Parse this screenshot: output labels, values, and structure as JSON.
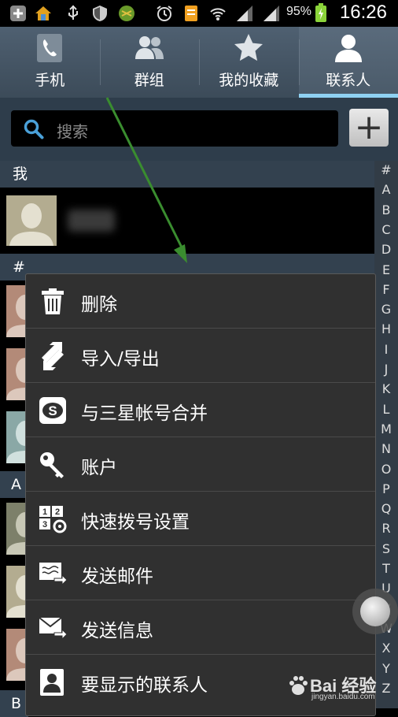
{
  "status_bar": {
    "battery": "95%",
    "time": "16:26",
    "icons": [
      "add-icon",
      "home-icon",
      "usb-icon",
      "shield-icon",
      "game-icon",
      "alarm-icon",
      "file-icon",
      "wifi-icon",
      "signal-icon",
      "signal-icon",
      "battery-charging-icon"
    ]
  },
  "tabs": [
    {
      "label": "手机",
      "icon": "phone-icon",
      "active": false
    },
    {
      "label": "群组",
      "icon": "group-icon",
      "active": false
    },
    {
      "label": "我的收藏",
      "icon": "star-icon",
      "active": false
    },
    {
      "label": "联系人",
      "icon": "person-icon",
      "active": true
    }
  ],
  "search": {
    "placeholder": "搜索",
    "add_label": "+"
  },
  "sections": {
    "me": "我",
    "hash": "#",
    "a": "A",
    "b": "B"
  },
  "index_letters": [
    "#",
    "A",
    "B",
    "C",
    "D",
    "E",
    "F",
    "G",
    "H",
    "I",
    "J",
    "K",
    "L",
    "M",
    "N",
    "O",
    "P",
    "Q",
    "R",
    "S",
    "T",
    "U",
    "V",
    "W",
    "X",
    "Y",
    "Z"
  ],
  "menu": {
    "items": [
      {
        "label": "删除",
        "icon": "trash-icon"
      },
      {
        "label": "导入/导出",
        "icon": "import-export-icon"
      },
      {
        "label": "与三星帐号合并",
        "icon": "samsung-account-icon"
      },
      {
        "label": "账户",
        "icon": "key-icon"
      },
      {
        "label": "快速拨号设置",
        "icon": "speed-dial-icon"
      },
      {
        "label": "发送邮件",
        "icon": "email-icon"
      },
      {
        "label": "发送信息",
        "icon": "message-icon"
      },
      {
        "label": "要显示的联系人",
        "icon": "contact-card-icon"
      }
    ]
  },
  "watermark": {
    "main": "Bai 经验",
    "sub": "jingyan.baidu.com"
  },
  "colors": {
    "tab_active_underline": "#8fd1f2",
    "header_bg": "#33414f",
    "arrow": "#3a8d2f"
  }
}
